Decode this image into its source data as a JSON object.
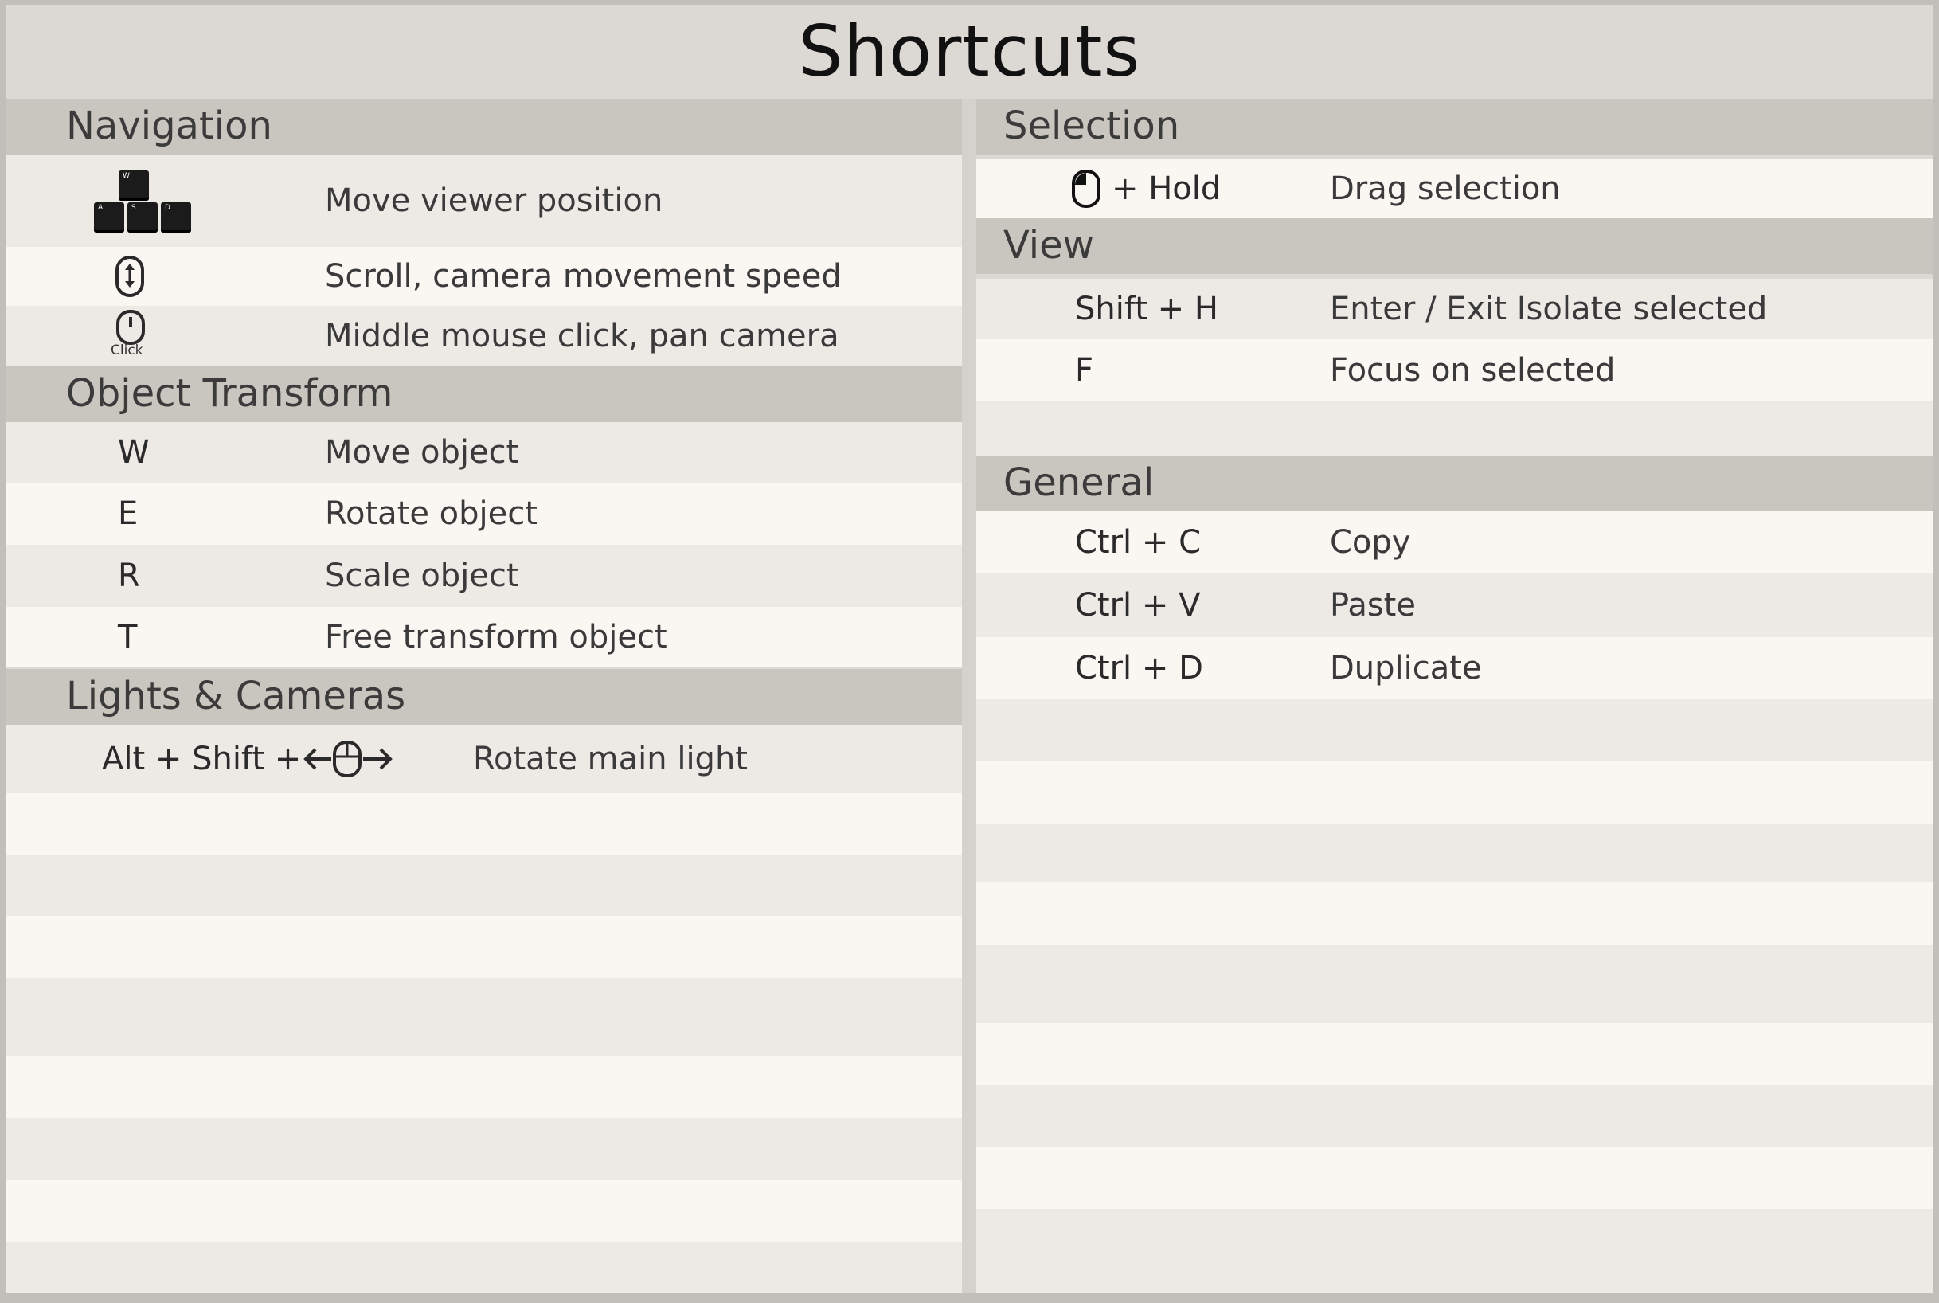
{
  "title": "Shortcuts",
  "left": {
    "navigation": {
      "heading": "Navigation",
      "rows": [
        {
          "keys": [
            "W",
            "A",
            "S",
            "D"
          ],
          "icon": "wasd-keys-icon",
          "desc": "Move viewer position"
        },
        {
          "icon": "mouse-scroll-icon",
          "desc": "Scroll, camera movement speed"
        },
        {
          "icon": "mouse-middle-click-icon",
          "icon_label": "Click",
          "desc": "Middle mouse click, pan camera"
        }
      ]
    },
    "object_transform": {
      "heading": "Object Transform",
      "rows": [
        {
          "key": "W",
          "desc": "Move object"
        },
        {
          "key": "E",
          "desc": "Rotate object"
        },
        {
          "key": "R",
          "desc": "Scale object"
        },
        {
          "key": "T",
          "desc": "Free transform object"
        }
      ]
    },
    "lights_cameras": {
      "heading": "Lights & Cameras",
      "rows": [
        {
          "key": "Alt + Shift +",
          "icon": "mouse-drag-horizontal-icon",
          "desc": "Rotate main light"
        }
      ]
    }
  },
  "right": {
    "selection": {
      "heading": "Selection",
      "rows": [
        {
          "icon": "mouse-left-click-icon",
          "key": "+ Hold",
          "desc": "Drag selection"
        }
      ]
    },
    "view": {
      "heading": "View",
      "rows": [
        {
          "key": "Shift + H",
          "desc": "Enter / Exit Isolate selected"
        },
        {
          "key": "F",
          "desc": "Focus on selected"
        }
      ]
    },
    "general": {
      "heading": "General",
      "rows": [
        {
          "key": "Ctrl + C",
          "desc": "Copy"
        },
        {
          "key": "Ctrl + V",
          "desc": "Paste"
        },
        {
          "key": "Ctrl + D",
          "desc": "Duplicate"
        }
      ]
    }
  }
}
